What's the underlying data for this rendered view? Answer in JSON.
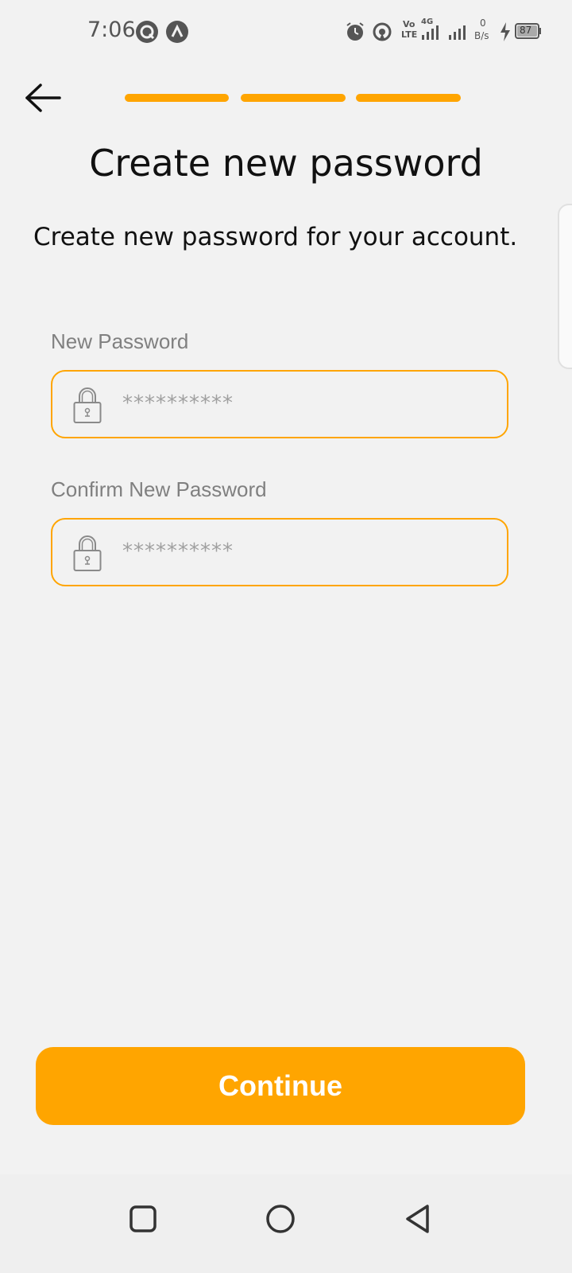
{
  "status_bar": {
    "time": "7:06",
    "network_speed_value": "0",
    "network_speed_unit": "B/s",
    "network_type_top": "Vo",
    "network_type_bottom": "LTE",
    "network_gen": "4G",
    "battery": "87"
  },
  "header": {
    "progress_steps": 3,
    "progress_completed": 3,
    "accent_color": "#ffa500"
  },
  "main": {
    "title": "Create new password",
    "subtitle": "Create new password for your account."
  },
  "form": {
    "new_password_label": "New Password",
    "new_password_value": "**********",
    "confirm_password_label": "Confirm New Password",
    "confirm_password_value": "**********"
  },
  "actions": {
    "continue_label": "Continue"
  },
  "icons": {
    "back": "arrow-left-icon",
    "lock": "lock-icon",
    "nav_recent": "square-icon",
    "nav_home": "circle-icon",
    "nav_back": "triangle-back-icon"
  }
}
